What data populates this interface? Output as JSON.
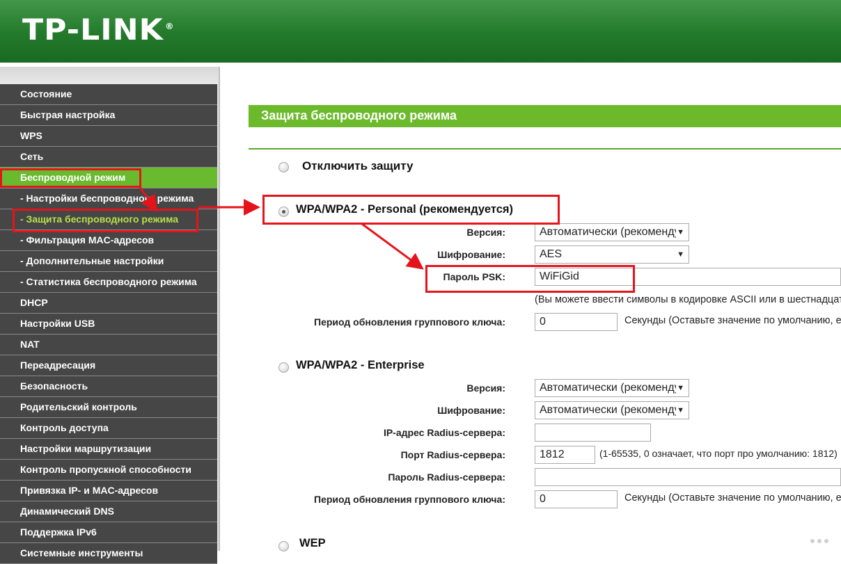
{
  "header": {
    "logo": "TP-LINK",
    "registered_mark": "®"
  },
  "sidebar": {
    "items": [
      {
        "label": "Состояние",
        "type": "top"
      },
      {
        "label": "Быстрая настройка",
        "type": "top"
      },
      {
        "label": "WPS",
        "type": "top"
      },
      {
        "label": "Сеть",
        "type": "top"
      },
      {
        "label": "Беспроводной режим",
        "type": "active"
      },
      {
        "label": "- Настройки беспроводного режима",
        "type": "sub"
      },
      {
        "label": "- Защита беспроводного режима",
        "type": "current"
      },
      {
        "label": "- Фильтрация MAC-адресов",
        "type": "sub"
      },
      {
        "label": "- Дополнительные настройки",
        "type": "sub"
      },
      {
        "label": "- Статистика беспроводного режима",
        "type": "sub"
      },
      {
        "label": "DHCP",
        "type": "top"
      },
      {
        "label": "Настройки USB",
        "type": "top"
      },
      {
        "label": "NAT",
        "type": "top"
      },
      {
        "label": "Переадресация",
        "type": "top"
      },
      {
        "label": "Безопасность",
        "type": "top"
      },
      {
        "label": "Родительский контроль",
        "type": "top"
      },
      {
        "label": "Контроль доступа",
        "type": "top"
      },
      {
        "label": "Настройки маршрутизации",
        "type": "top"
      },
      {
        "label": "Контроль пропускной способности",
        "type": "top"
      },
      {
        "label": "Привязка IP- и MAC-адресов",
        "type": "top"
      },
      {
        "label": "Динамический DNS",
        "type": "top"
      },
      {
        "label": "Поддержка IPv6",
        "type": "top"
      },
      {
        "label": "Системные инструменты",
        "type": "top"
      }
    ]
  },
  "main": {
    "title": "Защита беспроводного режима",
    "disable": {
      "label": "Отключить защиту",
      "checked": false
    },
    "personal": {
      "label": "WPA/WPA2 - Personal (рекомендуется)",
      "checked": true,
      "version_label": "Версия:",
      "version_value": "Автоматически (рекомендуется)",
      "encryption_label": "Шифрование:",
      "encryption_value": "AES",
      "psk_label": "Пароль PSK:",
      "psk_value": "WiFiGid",
      "psk_hint": "(Вы можете ввести символы в кодировке ASCII или в шестнадцатеричном формате)",
      "group_key_label": "Период обновления группового ключа:",
      "group_key_value": "0",
      "group_key_hint": "Секунды (Оставьте значение по умолчанию, если не уверены)"
    },
    "enterprise": {
      "label": "WPA/WPA2 - Enterprise",
      "checked": false,
      "version_label": "Версия:",
      "version_value": "Автоматически (рекомендуется)",
      "encryption_label": "Шифрование:",
      "encryption_value": "Автоматически (рекомендуется)",
      "radius_ip_label": "IP-адрес Radius-сервера:",
      "radius_ip_value": "",
      "radius_port_label": "Порт Radius-сервера:",
      "radius_port_value": "1812",
      "radius_port_hint": "(1-65535, 0 означает, что порт про умолчанию: 1812)",
      "radius_password_label": "Пароль Radius-сервера:",
      "radius_password_value": "",
      "group_key_label": "Период обновления группового ключа:",
      "group_key_value": "0",
      "group_key_hint": "Секунды (Оставьте значение по умолчанию, если не уверены)"
    },
    "wep": {
      "label": "WEP",
      "checked": false
    }
  },
  "colors": {
    "header_green": "#237a2b",
    "menu_dark": "#464646",
    "menu_active": "#6aba2f",
    "menu_current_text": "#b7e04a",
    "title_bar": "#6cba2c",
    "annotation_red": "#e5141b"
  }
}
